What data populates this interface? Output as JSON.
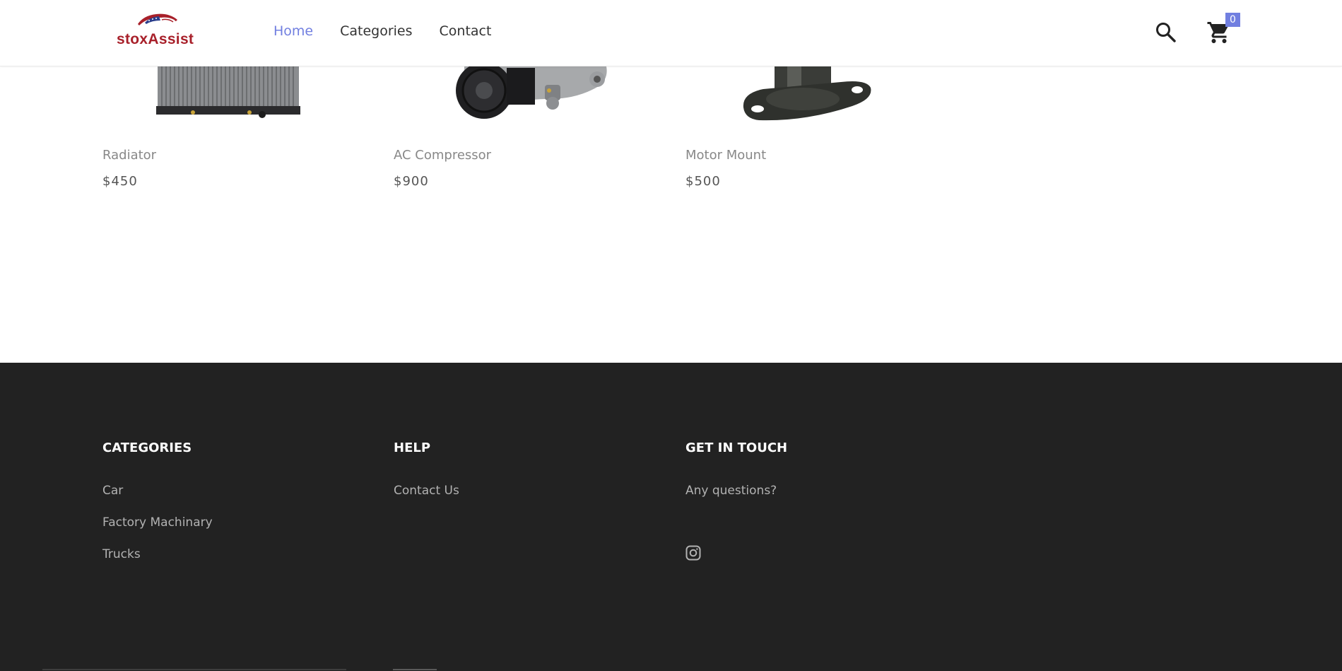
{
  "header": {
    "logo_text": "stoxAssist",
    "nav": [
      {
        "label": "Home",
        "active": true
      },
      {
        "label": "Categories",
        "active": false
      },
      {
        "label": "Contact",
        "active": false
      }
    ],
    "cart_count": "0",
    "accent_color": "#717fe0"
  },
  "products": [
    {
      "name": "Radiator",
      "price": "$450",
      "image": "radiator-image"
    },
    {
      "name": "AC Compressor",
      "price": "$900",
      "image": "ac-compressor-image"
    },
    {
      "name": "Motor Mount",
      "price": "$500",
      "image": "motor-mount-image"
    }
  ],
  "footer": {
    "categories": {
      "heading": "CATEGORIES",
      "links": [
        "Car",
        "Factory Machinary",
        "Trucks"
      ]
    },
    "help": {
      "heading": "HELP",
      "links": [
        "Contact Us"
      ]
    },
    "contact": {
      "heading": "GET IN TOUCH",
      "text": "Any questions?",
      "social_icon": "instagram-icon"
    },
    "background_color": "#222222"
  }
}
